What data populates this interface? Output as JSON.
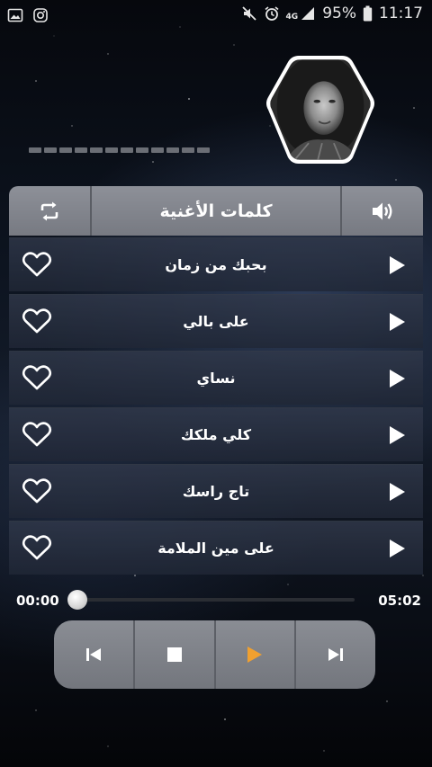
{
  "status_bar": {
    "battery": "95%",
    "time": "11:17",
    "network": "4G"
  },
  "header": {
    "title": "كلمات الأغنية"
  },
  "songs": [
    {
      "title": "بحبك من زمان"
    },
    {
      "title": "على بالي"
    },
    {
      "title": "نساي"
    },
    {
      "title": "كلي ملكك"
    },
    {
      "title": "تاج راسك"
    },
    {
      "title": "على مين الملامة"
    }
  ],
  "player": {
    "current_time": "00:00",
    "total_time": "05:02",
    "progress": 0
  },
  "colors": {
    "accent": "#f0a030",
    "panel": "#808389",
    "row": "#2a3244"
  },
  "icons": {
    "repeat": "repeat-icon",
    "volume": "volume-icon",
    "heart": "heart-outline-icon",
    "play": "play-icon",
    "previous": "skip-previous-icon",
    "stop": "stop-icon",
    "next": "skip-next-icon"
  }
}
